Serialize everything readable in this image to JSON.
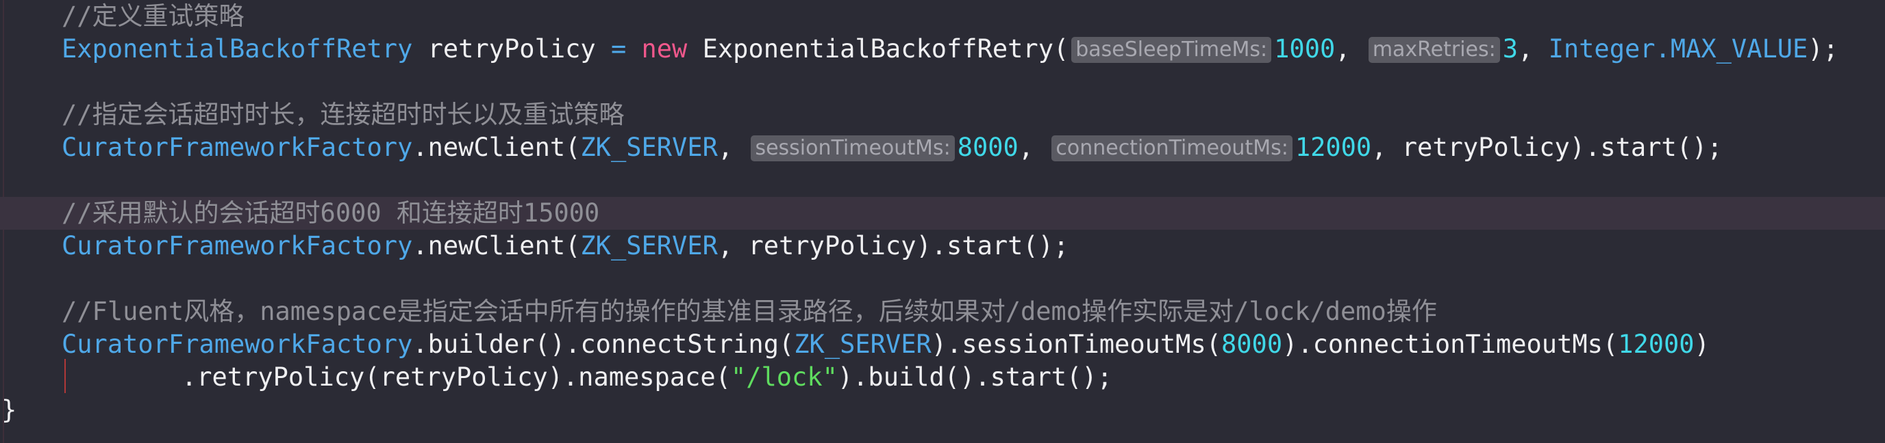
{
  "lines": {
    "l1": {
      "comment": "//定义重试策略"
    },
    "l2": {
      "type": "ExponentialBackoffRetry",
      "var": " retryPolicy ",
      "eq": "=",
      "kw": " new",
      "ctor": " ExponentialBackoffRetry(",
      "hint1": "baseSleepTimeMs:",
      "num1": "1000",
      "sep1": ",",
      "hint2": "maxRetries:",
      "num2": "3",
      "sep2": ", ",
      "type2": "Integer",
      "const": ".MAX_VALUE",
      "end": ");"
    },
    "l3": {
      "comment": "//指定会话超时时长，连接超时时长以及重试策略"
    },
    "l4": {
      "type": "CuratorFrameworkFactory",
      "call": ".newClient(",
      "const": "ZK_SERVER",
      "sep1": ",",
      "hint1": "sessionTimeoutMs:",
      "num1": "8000",
      "sep2": ",",
      "hint2": "connectionTimeoutMs:",
      "num2": "12000",
      "end": ", retryPolicy).start();"
    },
    "l5": {
      "comment": "//采用默认的会话超时6000 和连接超时15000"
    },
    "l6": {
      "type": "CuratorFrameworkFactory",
      "call": ".newClient(",
      "const": "ZK_SERVER",
      "end": ", retryPolicy).start();"
    },
    "l7": {
      "comment": "//Fluent风格，namespace是指定会话中所有的操作的基准目录路径，后续如果对/demo操作实际是对/lock/demo操作"
    },
    "l8": {
      "type": "CuratorFrameworkFactory",
      "call": ".builder().connectString(",
      "const": "ZK_SERVER",
      "mid": ").sessionTimeoutMs(",
      "num1": "8000",
      "mid2": ").connectionTimeoutMs(",
      "num2": "12000",
      "end": ")"
    },
    "l9": {
      "pre": ".retryPolicy(retryPolicy).namespace(",
      "str": "\"/lock\"",
      "end": ").build().start();"
    },
    "l10": {
      "brace": "}"
    }
  },
  "colors": {
    "background": "#2b2b35",
    "comment": "#8f8f96",
    "type": "#4fa8e8",
    "keyword": "#f0588c",
    "number": "#40d8e8",
    "string": "#5fdc5f",
    "hint_bg": "#5a5a62",
    "current_line": "#3a3340"
  }
}
